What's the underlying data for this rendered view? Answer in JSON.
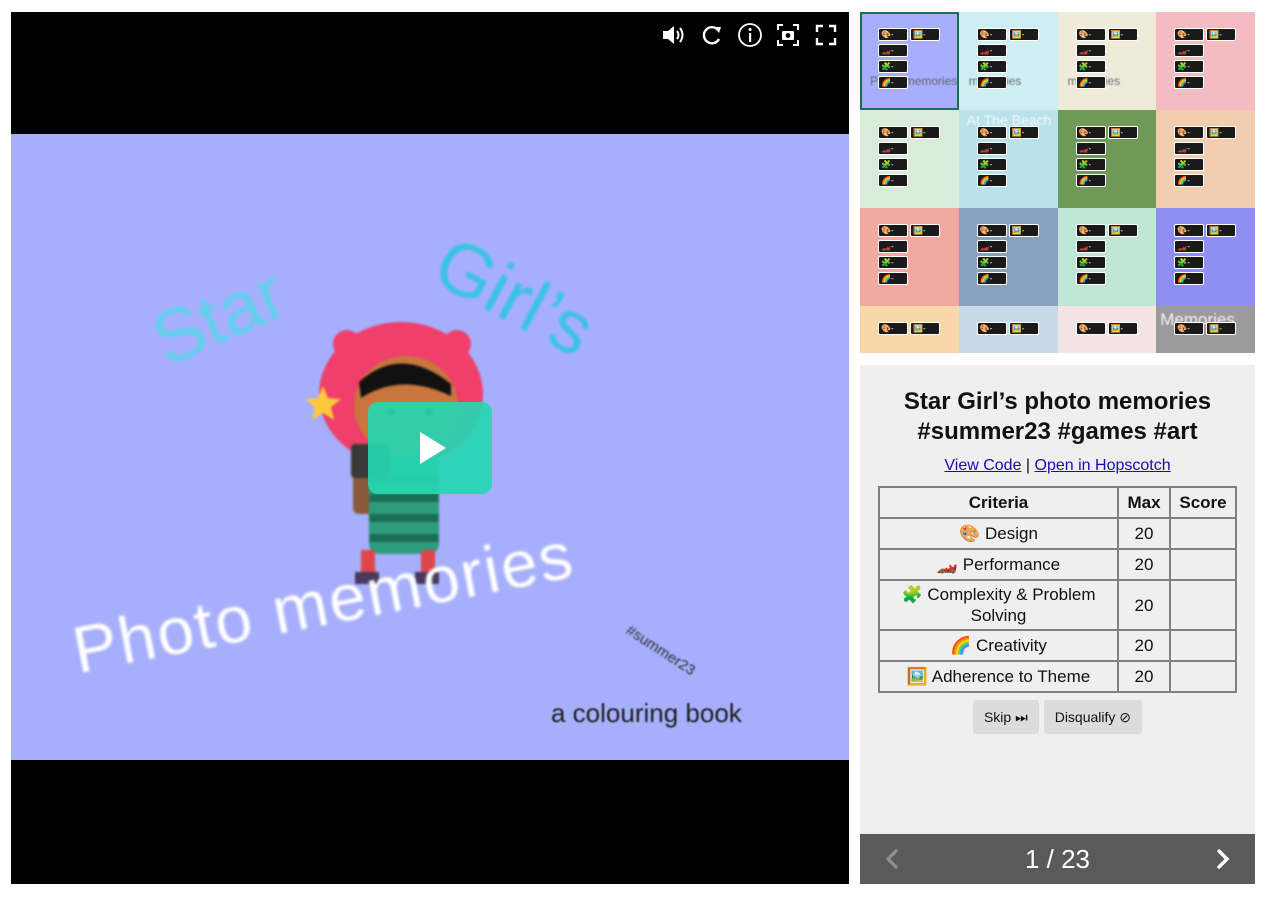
{
  "player": {
    "artwork": {
      "word_star": "Star",
      "word_girls": "Girl’s",
      "word_photo": "Photo memories",
      "hashtag": "#summer23",
      "subtitle": "a colouring book"
    },
    "controls": [
      "volume-icon",
      "restart-icon",
      "info-icon",
      "screenshot-icon",
      "fullscreen-icon"
    ],
    "play_button_color": "#26d6b2",
    "background_color": "#a7affc"
  },
  "thumbnails": [
    {
      "caption": "Photo memories",
      "bg": "#a7affc",
      "selected": true
    },
    {
      "caption": "memories",
      "bg": "#cfeef3",
      "selected": false
    },
    {
      "caption": "memories",
      "bg": "#f0eadb",
      "selected": false
    },
    {
      "caption": "",
      "bg": "#f2bcc0",
      "selected": false
    },
    {
      "caption": "",
      "bg": "#d9ecd9",
      "selected": false
    },
    {
      "caption": "At The Beach",
      "bg": "#b9e2ea",
      "selected": false
    },
    {
      "caption": "",
      "bg": "#6f9a57",
      "selected": false
    },
    {
      "caption": "",
      "bg": "#f3cdb0",
      "selected": false
    },
    {
      "caption": "",
      "bg": "#f3a9a0",
      "selected": false
    },
    {
      "caption": "",
      "bg": "#8aa0bf",
      "selected": false
    },
    {
      "caption": "",
      "bg": "#bfe6d6",
      "selected": false
    },
    {
      "caption": "",
      "bg": "#8f8ef2",
      "selected": false
    },
    {
      "caption": "",
      "bg": "#f6d9a6",
      "selected": false
    },
    {
      "caption": "",
      "bg": "#c9d8ea",
      "selected": false
    },
    {
      "caption": "",
      "bg": "#f4e4e6",
      "selected": false
    },
    {
      "caption": "Memories",
      "bg": "#9b9b9b",
      "selected": false
    }
  ],
  "panel": {
    "title_line1": "Star Girl’s photo memories",
    "title_line2": "#summer23 #games #art",
    "view_code": "View Code",
    "separator": "|",
    "open_in": "Open in Hopscotch",
    "table": {
      "headers": [
        "Criteria",
        "Max",
        "Score"
      ],
      "rows": [
        {
          "emoji": "🎨",
          "criteria": "Design",
          "max": "20",
          "score": ""
        },
        {
          "emoji": "🏎️",
          "criteria": "Performance",
          "max": "20",
          "score": ""
        },
        {
          "emoji": "🧩",
          "criteria": "Complexity & Problem Solving",
          "max": "20",
          "score": ""
        },
        {
          "emoji": "🌈",
          "criteria": "Creativity",
          "max": "20",
          "score": ""
        },
        {
          "emoji": "🖼️",
          "criteria": "Adherence to Theme",
          "max": "20",
          "score": ""
        }
      ]
    },
    "skip_label": "Skip ⏭",
    "disqualify_label": "Disqualify ⊘"
  },
  "pager": {
    "current": "1",
    "total": "23",
    "label": "1 / 23"
  }
}
